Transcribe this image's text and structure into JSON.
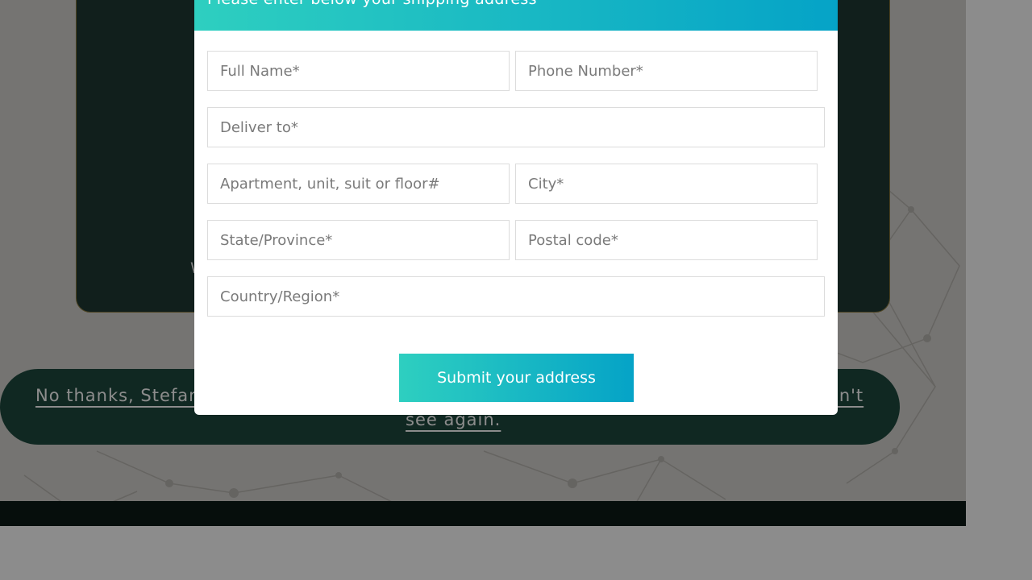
{
  "background": {
    "card_fragment": "W",
    "pill_text": "No thanks, Stefan… I don't want to claim my FREE BONUS I'll never see again.",
    "pill_visible_left": "No thanks, Stefan",
    "pill_visible_right": "on't",
    "pill_visible_line2": "see again."
  },
  "modal": {
    "title": "Please enter below your shipping address",
    "close_label": "×",
    "fields": {
      "full_name": "Full Name*",
      "phone": "Phone Number*",
      "deliver_to": "Deliver to*",
      "apartment": "Apartment, unit, suit or floor#",
      "city": "City*",
      "state": "State/Province*",
      "postal": "Postal code*",
      "country": "Country/Region*"
    },
    "submit_label": "Submit your address"
  },
  "colors": {
    "accent_start": "#2ecfc0",
    "accent_end": "#05a3c7"
  }
}
